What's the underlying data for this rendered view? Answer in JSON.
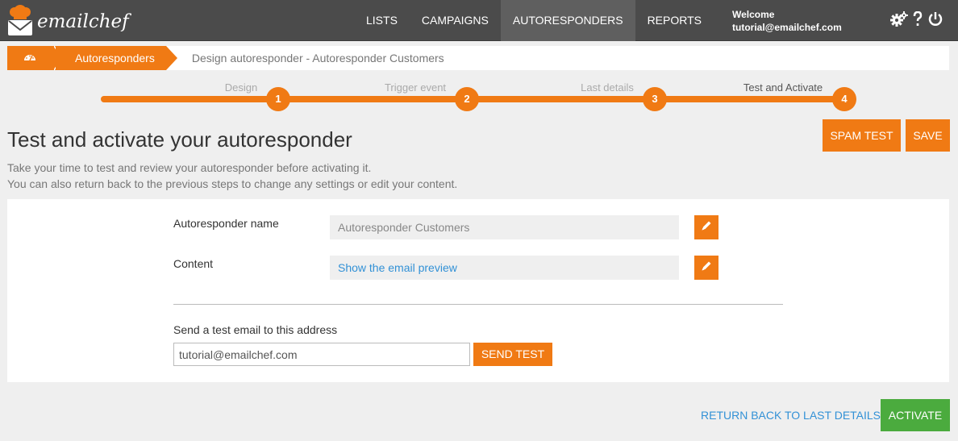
{
  "app": {
    "logo_text": "emailchef",
    "logo_icon": "chef-hat-envelope-icon"
  },
  "nav": {
    "items": [
      {
        "label": "LISTS"
      },
      {
        "label": "CAMPAIGNS"
      },
      {
        "label": "AUTORESPONDERS",
        "active": true
      },
      {
        "label": "REPORTS"
      }
    ]
  },
  "user": {
    "welcome": "Welcome",
    "email": "tutorial@emailchef.com"
  },
  "top_icons": [
    "gears-icon",
    "help-icon",
    "power-icon"
  ],
  "breadcrumb": {
    "home_icon": "dashboard-icon",
    "section": "Autoresponders",
    "current": "Design autoresponder - Autoresponder Customers"
  },
  "stepper": {
    "steps": [
      {
        "label": "Design",
        "number": "1"
      },
      {
        "label": "Trigger event",
        "number": "2"
      },
      {
        "label": "Last details",
        "number": "3"
      },
      {
        "label": "Test and Activate",
        "number": "4",
        "current": true
      }
    ]
  },
  "page": {
    "title": "Test and activate your autoresponder",
    "intro_line1": "Take your time to test and review your autoresponder before activating it.",
    "intro_line2": "You can also return back to the previous steps to change any settings or edit your content.",
    "spam_test_label": "SPAM TEST",
    "save_label": "SAVE"
  },
  "form": {
    "name_label": "Autoresponder name",
    "name_value": "Autoresponder Customers",
    "content_label": "Content",
    "content_link": "Show the email preview",
    "edit_icon": "pencil-icon",
    "test_label": "Send a test email to this address",
    "test_email": "tutorial@emailchef.com",
    "send_test_label": "SEND TEST"
  },
  "footer": {
    "return_label": "RETURN BACK TO LAST DETAILS",
    "activate_label": "ACTIVATE"
  },
  "colors": {
    "accent": "#f07a14",
    "topbar": "#4b4b4b",
    "success": "#4bab3e",
    "link": "#3291d6"
  }
}
